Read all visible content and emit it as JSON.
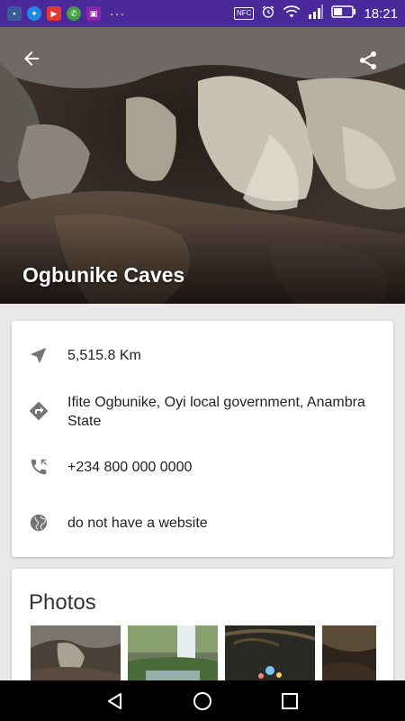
{
  "status_bar": {
    "time": "18:21",
    "nfc": "NFC",
    "overflow": "···",
    "apps": [
      "messenger-app-icon",
      "messenger-icon",
      "youtube-icon",
      "whatsapp-icon",
      "gallery-icon"
    ],
    "colors": {
      "background": "#4a2a9a"
    }
  },
  "hero": {
    "title": "Ogbunike Caves"
  },
  "info": {
    "distance": "5,515.8 Km",
    "address": "Ifite Ogbunike, Oyi local government, Anambra State",
    "phone": "+234 800 000 0000",
    "website": "do not have a website"
  },
  "photos": {
    "title": "Photos"
  },
  "nav_bar": {
    "buttons": [
      "back-triangle-icon",
      "home-circle-icon",
      "recents-square-icon"
    ]
  },
  "colors": {
    "icon_gray": "#757575",
    "page_bg": "#e8e8e8"
  }
}
